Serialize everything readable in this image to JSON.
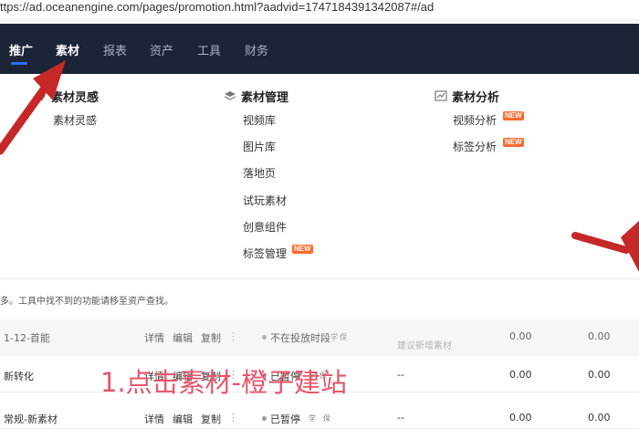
{
  "browser": {
    "url": "ttps://ad.oceanengine.com/pages/promotion.html?aadvid=1747184391342087#/ad"
  },
  "nav": {
    "items": [
      "推广",
      "素材",
      "报表",
      "资产",
      "工具",
      "财务"
    ],
    "active": "推广"
  },
  "menu": {
    "col1": {
      "title": "素材灵感",
      "items": [
        "素材灵感"
      ]
    },
    "col2": {
      "title": "素材管理",
      "items": [
        "视频库",
        "图片库",
        "落地页",
        "试玩素材",
        "创意组件",
        "标签管理"
      ]
    },
    "col3": {
      "title": "素材分析",
      "items": [
        "视频分析",
        "标签分析"
      ]
    },
    "new_badge": "NEW"
  },
  "notice": "多。工具中找不到的功能请移至资产查找。",
  "table": {
    "rows": [
      {
        "name": "1-12-首能",
        "actions": [
          "详情",
          "编辑",
          "复制"
        ],
        "more": "⋮",
        "status": "不在投放时段",
        "tags": [
          "学",
          "保"
        ],
        "suggestion": "建议新增素材",
        "v1": "0.00",
        "v2": "0.00"
      },
      {
        "name": "新转化",
        "actions": [
          "详情",
          "编辑",
          "复制"
        ],
        "more": "⋮",
        "status": "已暂停",
        "tags": [
          "学",
          "保"
        ],
        "suggestion": "--",
        "v1": "0.00",
        "v2": "0.00"
      },
      {
        "name": "常规-新素材",
        "actions": [
          "详情",
          "编辑",
          "复制"
        ],
        "more": "⋮",
        "status": "已暂停",
        "tags": [
          "学",
          "保"
        ],
        "suggestion": "--",
        "v1": "0.00",
        "v2": "0.00"
      }
    ]
  },
  "overlay": {
    "caption": "1.点击素材-橙子建站"
  },
  "colors": {
    "nav_bg": "#1c2438",
    "accent": "#2f6bff",
    "new_badge": "#ff6a2b",
    "caption": "#e6566a",
    "arrow": "#c62828"
  }
}
